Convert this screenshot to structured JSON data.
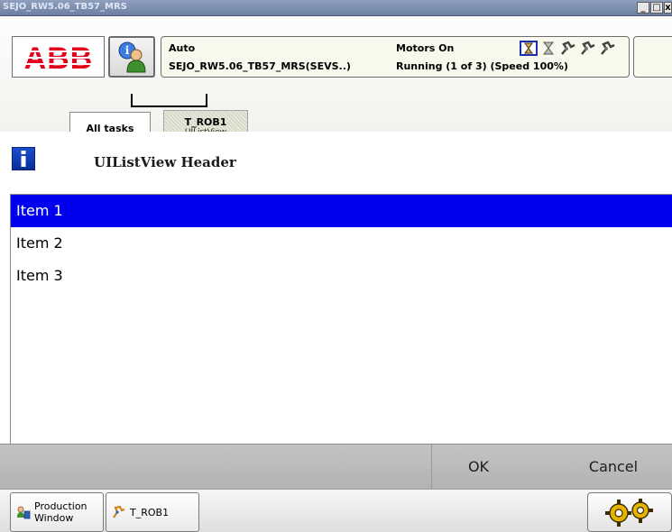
{
  "window": {
    "title": "SEJO_RW5.06_TB57_MRS",
    "minimize": "_",
    "maximize": "□",
    "close": "x"
  },
  "header": {
    "logo_text": "ABB",
    "operating_mode": "Auto",
    "system_name": "SEJO_RW5.06_TB57_MRS(SEVS..)",
    "motor_state": "Motors On",
    "run_state": "Running (1 of 3) (Speed 100%)",
    "status_icons": [
      "hourglass-icon",
      "hourglass-icon",
      "robot-arm-icon",
      "robot-arm-icon",
      "robot-arm-icon"
    ]
  },
  "tabs": {
    "all_tasks": "All tasks",
    "task_name": "T_ROB1",
    "task_view": "UIListView"
  },
  "content": {
    "header_title": "UIListView Header",
    "items": [
      {
        "label": "Item 1",
        "selected": true
      },
      {
        "label": "Item 2",
        "selected": false
      },
      {
        "label": "Item 3",
        "selected": false
      }
    ]
  },
  "buttons": {
    "ok": "OK",
    "cancel": "Cancel"
  },
  "taskbar": {
    "production_line1": "Production",
    "production_line2": "Window",
    "trob1": "T_ROB1"
  },
  "colors": {
    "selection": "#0000ee",
    "abb_red": "#e2001a",
    "title_bar": "#7b8cae",
    "button_bar": "#bdbdbd"
  }
}
